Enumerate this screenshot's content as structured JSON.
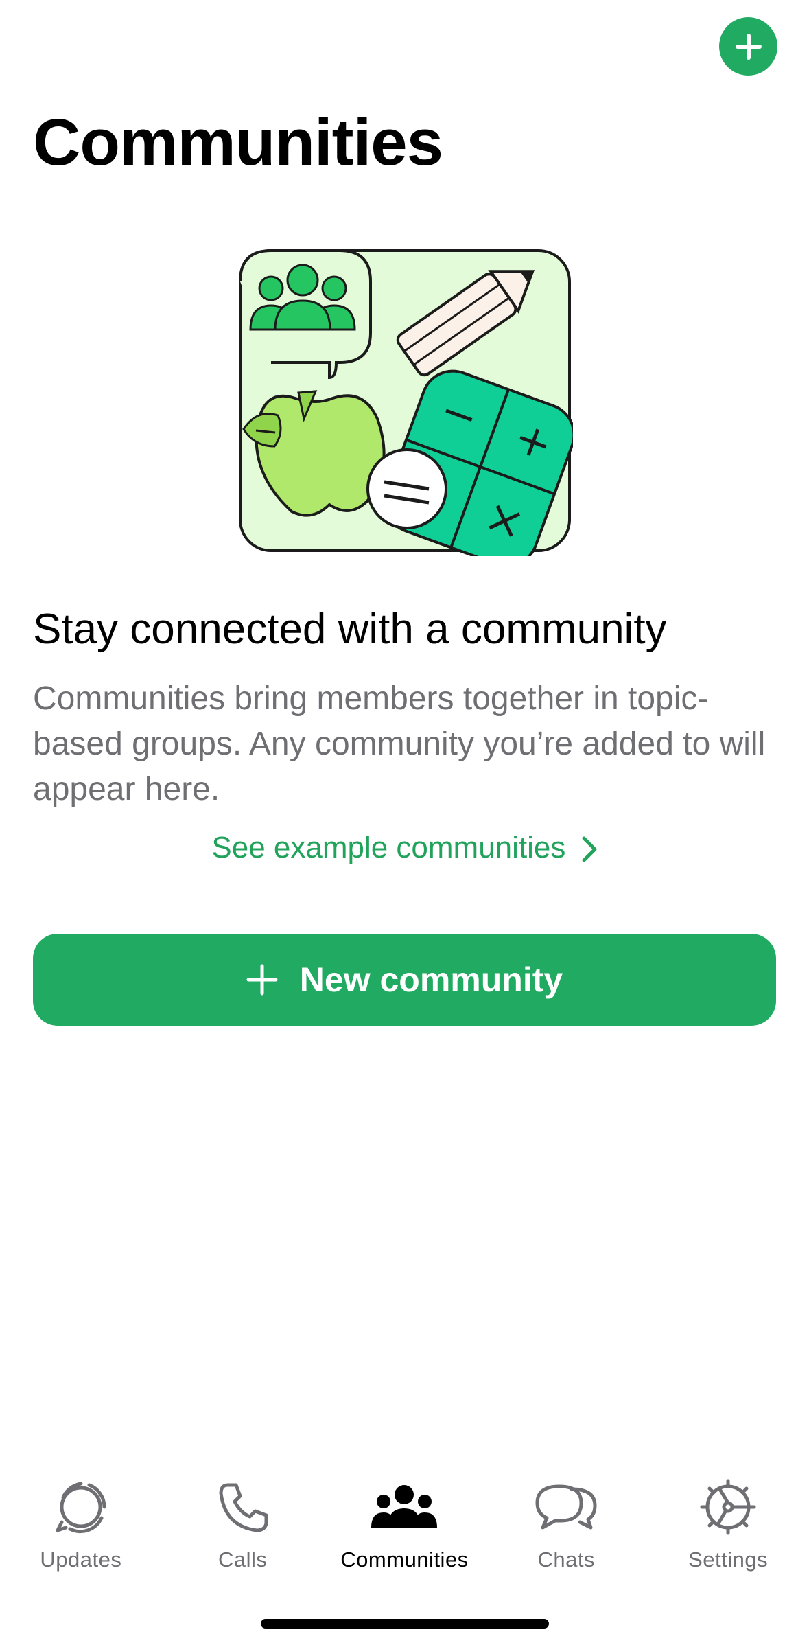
{
  "header": {
    "title": "Communities",
    "add_button_icon": "plus-icon"
  },
  "illustration": {
    "icon": "communities-illustration"
  },
  "empty_state": {
    "headline": "Stay connected with a community",
    "description": "Communities bring members together in topic-based groups. Any community you’re added to will appear here.",
    "link_label": "See example communities"
  },
  "primary_action": {
    "label": "New community",
    "icon": "plus-icon"
  },
  "tabbar": {
    "items": [
      {
        "label": "Updates",
        "icon": "updates-icon",
        "active": false
      },
      {
        "label": "Calls",
        "icon": "phone-icon",
        "active": false
      },
      {
        "label": "Communities",
        "icon": "communities-icon",
        "active": true
      },
      {
        "label": "Chats",
        "icon": "chats-icon",
        "active": false
      },
      {
        "label": "Settings",
        "icon": "gear-icon",
        "active": false
      }
    ]
  },
  "colors": {
    "accent": "#21aa61",
    "link": "#21a35c",
    "secondary_text": "#6e6e73"
  }
}
